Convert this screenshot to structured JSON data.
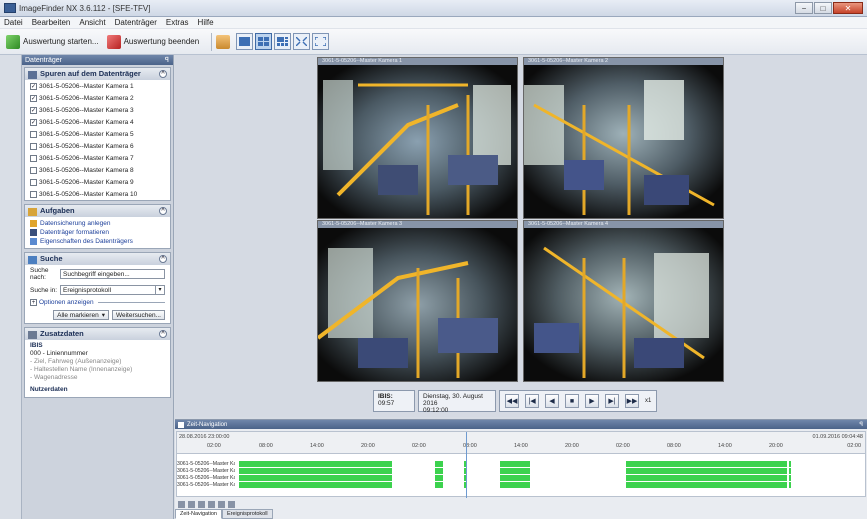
{
  "window": {
    "title": "ImageFinder NX 3.6.112 - [SFE-TFV]",
    "controls": [
      "−",
      "□",
      "✕"
    ]
  },
  "menu": [
    "Datei",
    "Bearbeiten",
    "Ansicht",
    "Datenträger",
    "Extras",
    "Hilfe"
  ],
  "toolbar": {
    "start_label": "Auswertung starten...",
    "stop_label": "Auswertung beenden"
  },
  "leftpanel": {
    "title": "Datenträger",
    "pin": "ꟼ",
    "tracks": {
      "title": "Spuren auf dem Datenträger",
      "items": [
        {
          "label": "3061-5-05206--Master Kamera 1",
          "checked": true
        },
        {
          "label": "3061-5-05206--Master Kamera 2",
          "checked": true
        },
        {
          "label": "3061-5-05206--Master Kamera 3",
          "checked": true
        },
        {
          "label": "3061-5-05206--Master Kamera 4",
          "checked": true
        },
        {
          "label": "3061-5-05206--Master Kamera 5",
          "checked": false
        },
        {
          "label": "3061-5-05206--Master Kamera 6",
          "checked": false
        },
        {
          "label": "3061-5-05206--Master Kamera 7",
          "checked": false
        },
        {
          "label": "3061-5-05206--Master Kamera 8",
          "checked": false
        },
        {
          "label": "3061-5-05206--Master Kamera 9",
          "checked": false
        },
        {
          "label": "3061-5-05206--Master Kamera 10",
          "checked": false
        }
      ]
    },
    "tasks": {
      "title": "Aufgaben",
      "items": [
        "Datensicherung anlegen",
        "Datenträger formatieren",
        "Eigenschaften des Datenträgers"
      ]
    },
    "search": {
      "title": "Suche",
      "search_for_label": "Suche nach:",
      "search_for_value": "Suchbegriff eingeben...",
      "search_in_label": "Suche in:",
      "search_in_value": "Ereignisprotokoll",
      "options_label": "Optionen anzeigen",
      "mark_all": "Alle markieren",
      "continue": "Weitersuchen..."
    },
    "extra": {
      "title": "Zusatzdaten",
      "ibis": "IBIS",
      "lines": [
        "000 - Liniennummer",
        "- Ziel, Fahrweg (Außenanzeige)",
        "- Haltestellen Name (Innenanzeige)",
        "- Wagenadresse"
      ],
      "user_data": "Nutzerdaten"
    }
  },
  "cameras": [
    {
      "title": "3061-5-05206--Master Kamera 1"
    },
    {
      "title": "3061-5-05206--Master Kamera 2"
    },
    {
      "title": "3061-5-05206--Master Kamera 3"
    },
    {
      "title": "3061-5-05206--Master Kamera 4"
    }
  ],
  "playback": {
    "ibis_label": "IBIS:",
    "ibis_time": "09:57",
    "date": "Dienstag, 30. August 2016",
    "time": "09:12:00",
    "speed": "x1"
  },
  "timeline": {
    "title": "Zeit-Navigation",
    "pin": "ꟼ",
    "start": "28.08.2016 23:00:00",
    "start_time": "02:00",
    "end": "01.09.2016 09:04:48",
    "end_time": "02:00",
    "ticks": [
      "08:00",
      "14:00",
      "20:00",
      "02:00",
      "08:00",
      "14:00",
      "20:00",
      "02:00",
      "08:00",
      "14:00",
      "20:00"
    ],
    "rows": [
      "3061-5-05206--Master Kamera 1",
      "3061-5-05206--Master Kamera 2",
      "3061-5-05206--Master Kamera 3",
      "3061-5-05206--Master Kamera 4"
    ],
    "tabs": [
      "Zeit-Navigation",
      "Ereignisprotokoll"
    ]
  },
  "colors": {
    "accent": "#4b6389",
    "recording": "#3cd24e"
  }
}
